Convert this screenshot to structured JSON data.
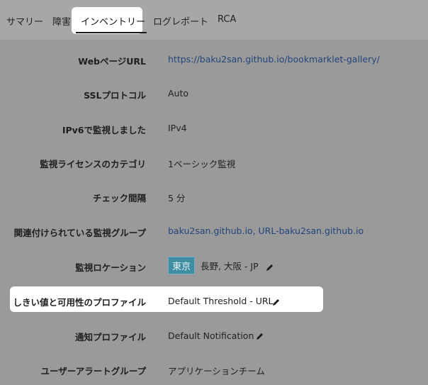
{
  "tabs": [
    "サマリー",
    "障害",
    "インベントリー",
    "ログレポート",
    "RCA"
  ],
  "active_tab": "インベントリー",
  "rows": [
    {
      "label": "WebページURL",
      "value": "https://baku2san.github.io/bookmarklet-gallery/"
    },
    {
      "label": "SSLプロトコル",
      "value": "Auto"
    },
    {
      "label": "IPv6で監視しました",
      "value": "IPv4"
    },
    {
      "label": "監視ライセンスのカテゴリ",
      "value": "1ベーシック監視"
    },
    {
      "label": "チェック間隔",
      "value": "5 分"
    },
    {
      "label": "関連付けられている監視グループ",
      "value": "baku2san.github.io, URL-baku2san.github.io"
    },
    {
      "label": "監視ロケーション",
      "badge": "東京",
      "value": "長野, 大阪 - JP"
    },
    {
      "label": "しきい値と可用性のプロファイル",
      "value": "Default Threshold - URL"
    },
    {
      "label": "通知プロファイル",
      "value": "Default Notification"
    },
    {
      "label": "ユーザーアラートグループ",
      "value": "アプリケーションチーム"
    }
  ],
  "icons": {
    "edit": "pencil-icon"
  },
  "colors": {
    "link": "#22457a",
    "badge": "#3f8da3",
    "background": "#9a9a9a",
    "highlight": "#ffffff"
  }
}
